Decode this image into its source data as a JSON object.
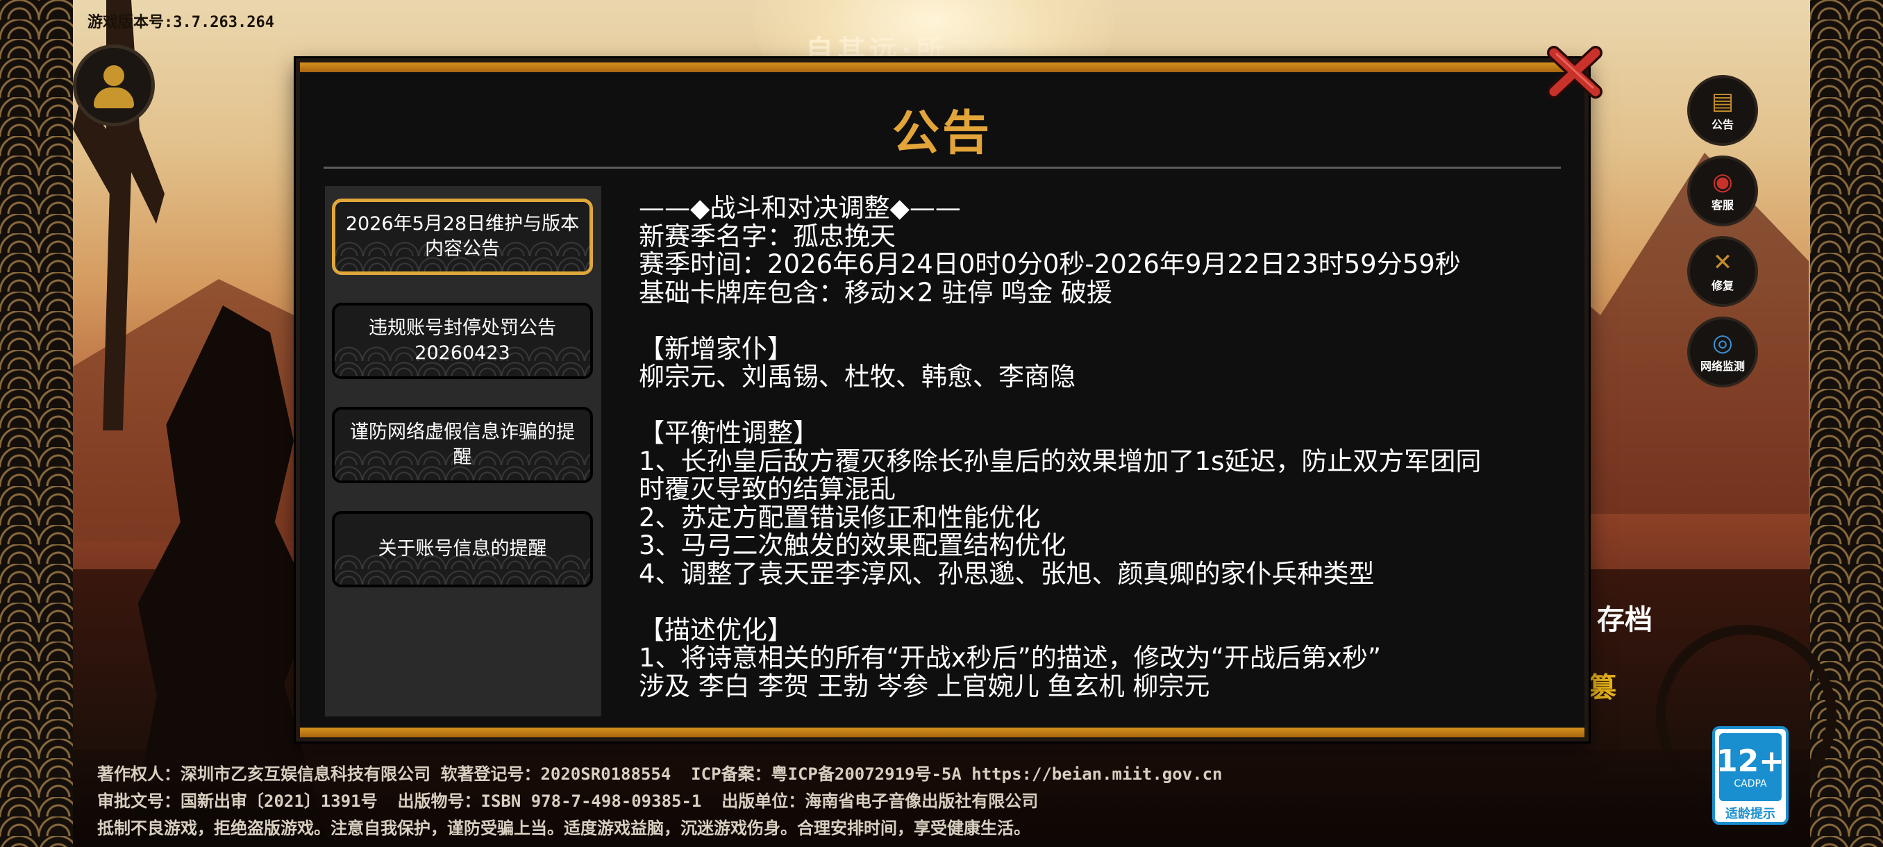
{
  "header": {
    "version": "游戏版本号:3.7.263.264",
    "partial_title": "自其远·所"
  },
  "side_menu": [
    {
      "label": "公告",
      "icon": "scroll-icon"
    },
    {
      "label": "客服",
      "icon": "customer-service-icon"
    },
    {
      "label": "修复",
      "icon": "repair-tools-icon"
    },
    {
      "label": "网络监测",
      "icon": "wifi-icon"
    }
  ],
  "background_partial": {
    "save_text": "存档",
    "glyph": "篡"
  },
  "modal": {
    "title": "公告",
    "tabs": [
      {
        "label": "2026年5月28日维护与版本内容公告",
        "active": true
      },
      {
        "label": "违规账号封停处罚公告20260423",
        "active": false
      },
      {
        "label": "谨防网络虚假信息诈骗的提醒",
        "active": false
      },
      {
        "label": "关于账号信息的提醒",
        "active": false
      }
    ],
    "content_lines": [
      "——◆战斗和对决调整◆——",
      "新赛季名字：孤忠挽天",
      "赛季时间：2026年6月24日0时0分0秒-2026年9月22日23时59分59秒",
      "基础卡牌库包含：移动×2 驻停 鸣金 破援",
      "",
      "【新增家仆】",
      "柳宗元、刘禹锡、杜牧、韩愈、李商隐",
      "",
      "【平衡性调整】",
      "1、长孙皇后敌方覆灭移除长孙皇后的效果增加了1s延迟，防止双方军团同",
      "时覆灭导致的结算混乱",
      "2、苏定方配置错误修正和性能优化",
      "3、马弓二次触发的效果配置结构优化",
      "4、调整了袁天罡李淳风、孙思邈、张旭、颜真卿的家仆兵种类型",
      "",
      "【描述优化】",
      "1、将诗意相关的所有“开战x秒后”的描述，修改为“开战后第x秒”",
      "涉及 李白 李贺 王勃 岑参 上官婉儿 鱼玄机 柳宗元"
    ]
  },
  "footer": {
    "line1": "著作权人：深圳市乙亥互娱信息科技有限公司 软著登记号：2020SR0188554  ICP备案：粤ICP备20072919号-5A https://beian.miit.gov.cn",
    "line2": "审批文号：国新出审〔2021〕1391号  出版物号：ISBN 978-7-498-09385-1  出版单位：海南省电子音像出版社有限公司",
    "line3": "抵制不良游戏，拒绝盗版游戏。注意自我保护，谨防受骗上当。适度游戏益脑，沉迷游戏伤身。合理安排时间，享受健康生活。"
  },
  "age_rating": {
    "age": "12+",
    "org": "CADPA",
    "tip": "适龄提示"
  },
  "colors": {
    "accent_gold": "#e3a53a",
    "close_red": "#c9322a",
    "modal_bg": "#0f0f0f"
  }
}
